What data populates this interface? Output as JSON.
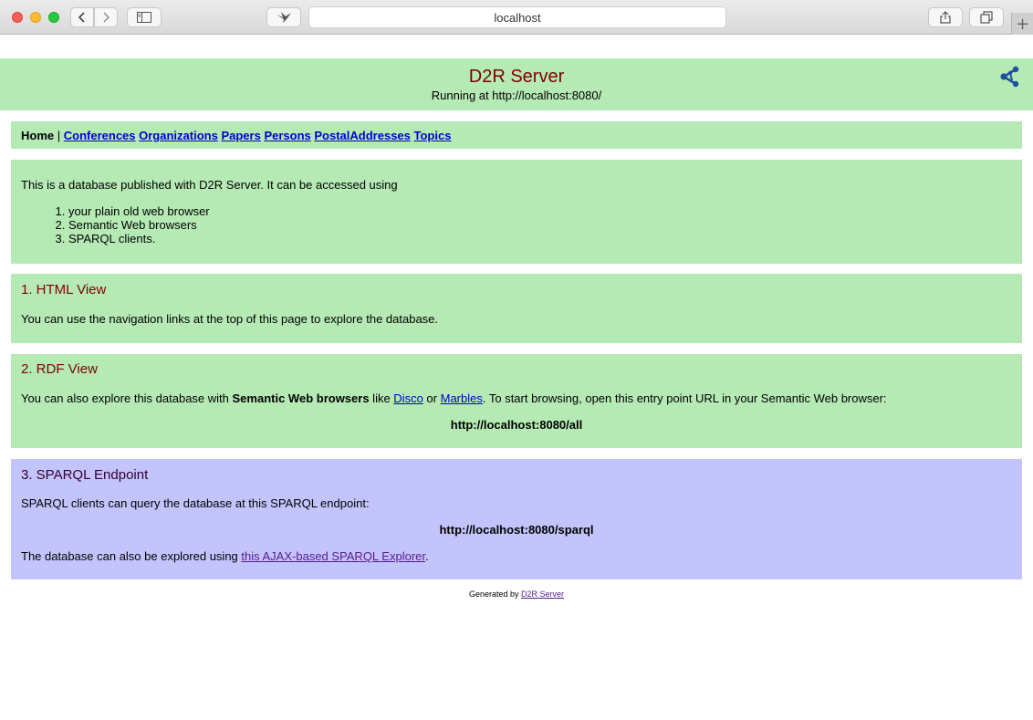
{
  "browser": {
    "url": "localhost"
  },
  "banner": {
    "title": "D2R Server",
    "subtitle": "Running at http://localhost:8080/"
  },
  "nav": {
    "home": "Home",
    "separator": "|",
    "links": [
      "Conferences",
      "Organizations",
      "Papers",
      "Persons",
      "PostalAddresses",
      "Topics"
    ]
  },
  "intro": {
    "text": "This is a database published with D2R Server. It can be accessed using",
    "items": [
      "your plain old web browser",
      "Semantic Web browsers",
      "SPARQL clients."
    ]
  },
  "html_view": {
    "heading": "1. HTML View",
    "text": "You can use the navigation links at the top of this page to explore the database."
  },
  "rdf_view": {
    "heading": "2. RDF View",
    "text_before": "You can also explore this database with ",
    "bold": "Semantic Web browsers",
    "like": " like ",
    "link1": "Disco",
    "or": " or ",
    "link2": "Marbles",
    "text_after": ". To start browsing, open this entry point URL in your Semantic Web browser:",
    "entry_url": "http://localhost:8080/all"
  },
  "sparql": {
    "heading": "3. SPARQL Endpoint",
    "text": "SPARQL clients can query the database at this SPARQL endpoint:",
    "endpoint": "http://localhost:8080/sparql",
    "explore_before": "The database can also be explored using ",
    "explore_link": "this AJAX-based SPARQL Explorer",
    "explore_after": "."
  },
  "footer": {
    "prefix": "Generated by ",
    "link": "D2R Server"
  },
  "colors": {
    "section_bg": "#b5eab4",
    "sparql_bg": "#c4c4fd",
    "heading": "#800000",
    "link": "#0000cc"
  }
}
